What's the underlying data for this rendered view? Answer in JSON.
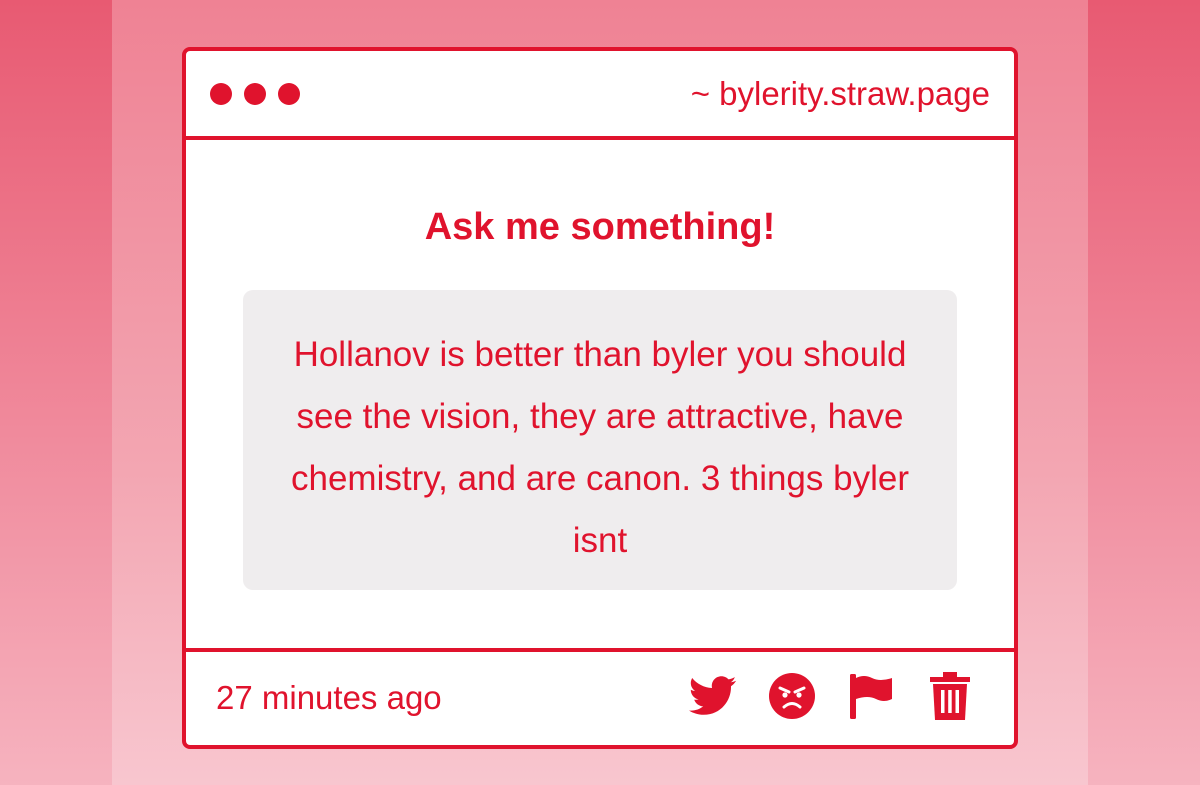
{
  "window": {
    "url": "~ bylerity.straw.page"
  },
  "content": {
    "heading": "Ask me something!",
    "question": "Hollanov is better than byler you should see the vision, they are attractive, have chemistry, and are canon. 3 things byler isnt"
  },
  "footer": {
    "timestamp": "27 minutes ago",
    "actions": [
      "twitter-share-icon",
      "angry-face-icon",
      "flag-icon",
      "trash-icon"
    ]
  },
  "colors": {
    "accent": "#e0132d",
    "question_background": "#efedee",
    "page_background": "#f08a9c"
  }
}
